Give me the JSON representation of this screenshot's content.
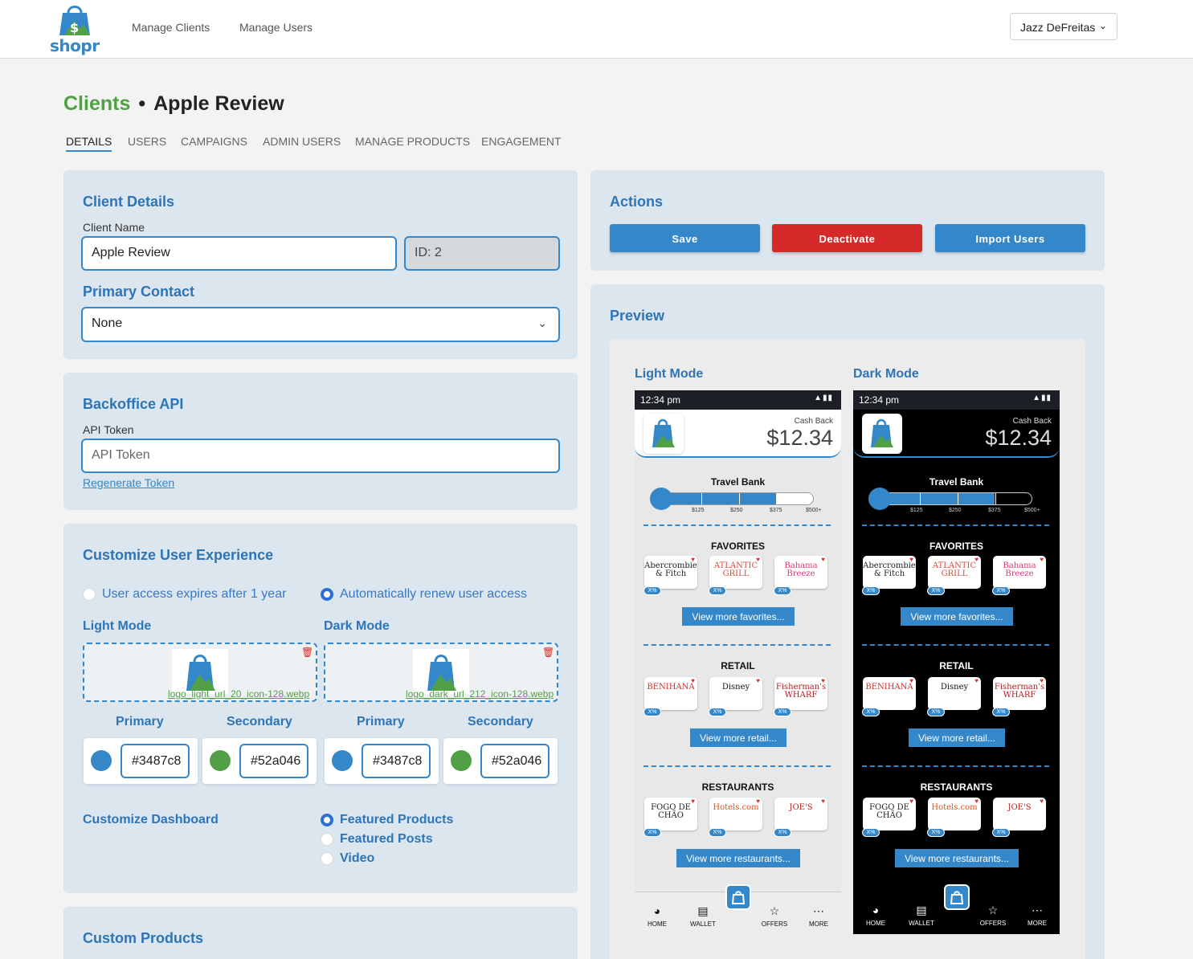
{
  "nav": {
    "brand": "shopr",
    "links": [
      "Manage Clients",
      "Manage Users"
    ],
    "user": "Jazz DeFreitas"
  },
  "header": {
    "crumb_root": "Clients",
    "crumb_current": "Apple Review",
    "tabs": [
      "DETAILS",
      "USERS",
      "CAMPAIGNS",
      "ADMIN USERS",
      "MANAGE PRODUCTS",
      "ENGAGEMENT"
    ],
    "active_tab": "DETAILS"
  },
  "client_details": {
    "title": "Client Details",
    "name_label": "Client Name",
    "name_value": "Apple Review",
    "id_value": "ID: 2",
    "contact_title": "Primary Contact",
    "contact_value": "None"
  },
  "backoffice": {
    "title": "Backoffice API",
    "token_label": "API Token",
    "token_placeholder": "API Token",
    "regenerate": "Regenerate Token"
  },
  "customize": {
    "title": "Customize User Experience",
    "access_options": [
      "User access expires after 1 year",
      "Automatically renew user access"
    ],
    "access_selected": 1,
    "light_title": "Light Mode",
    "dark_title": "Dark Mode",
    "light_file": "logo_light_url_20_icon-128.webp",
    "dark_file": "logo_dark_url_212_icon-128.webp",
    "primary_label": "Primary",
    "secondary_label": "Secondary",
    "light_primary": "#3487c8",
    "light_secondary": "#52a046",
    "dark_primary": "#3487c8",
    "dark_secondary": "#52a046",
    "dashboard_title": "Customize Dashboard",
    "dashboard_options": [
      "Featured Products",
      "Featured Posts",
      "Video"
    ],
    "dashboard_selected": 0
  },
  "custom_products": {
    "title": "Custom Products"
  },
  "actions": {
    "title": "Actions",
    "save": "Save",
    "deactivate": "Deactivate",
    "import": "Import Users"
  },
  "preview": {
    "title": "Preview",
    "light_title": "Light Mode",
    "dark_title": "Dark Mode",
    "time": "12:34 pm",
    "cashback_label": "Cash Back",
    "cashback_amount": "$12.34",
    "travel_bank": "Travel Bank",
    "travel_progress": 0.75,
    "travel_ticks": [
      "$125",
      "$250",
      "$375",
      "$500+"
    ],
    "favorites_title": "FAVORITES",
    "favorites": [
      "Abercrombie & Fitch",
      "ATLANTIC GRILL",
      "Bahama Breeze"
    ],
    "favorites_more": "View more favorites...",
    "retail_title": "RETAIL",
    "retail": [
      "BENIHANA",
      "Disney",
      "Fisherman's WHARF"
    ],
    "retail_more": "View more retail...",
    "restaurants_title": "RESTAURANTS",
    "restaurants": [
      "FOGO DE CHÃO",
      "Hotels.com",
      "JOE'S"
    ],
    "restaurants_more": "View more restaurants...",
    "badge": "X%",
    "tabs": [
      "HOME",
      "WALLET",
      "OFFERS",
      "MORE"
    ]
  },
  "colors": {
    "primary": "#3487c8",
    "secondary": "#52a046",
    "danger": "#d62a2a"
  }
}
